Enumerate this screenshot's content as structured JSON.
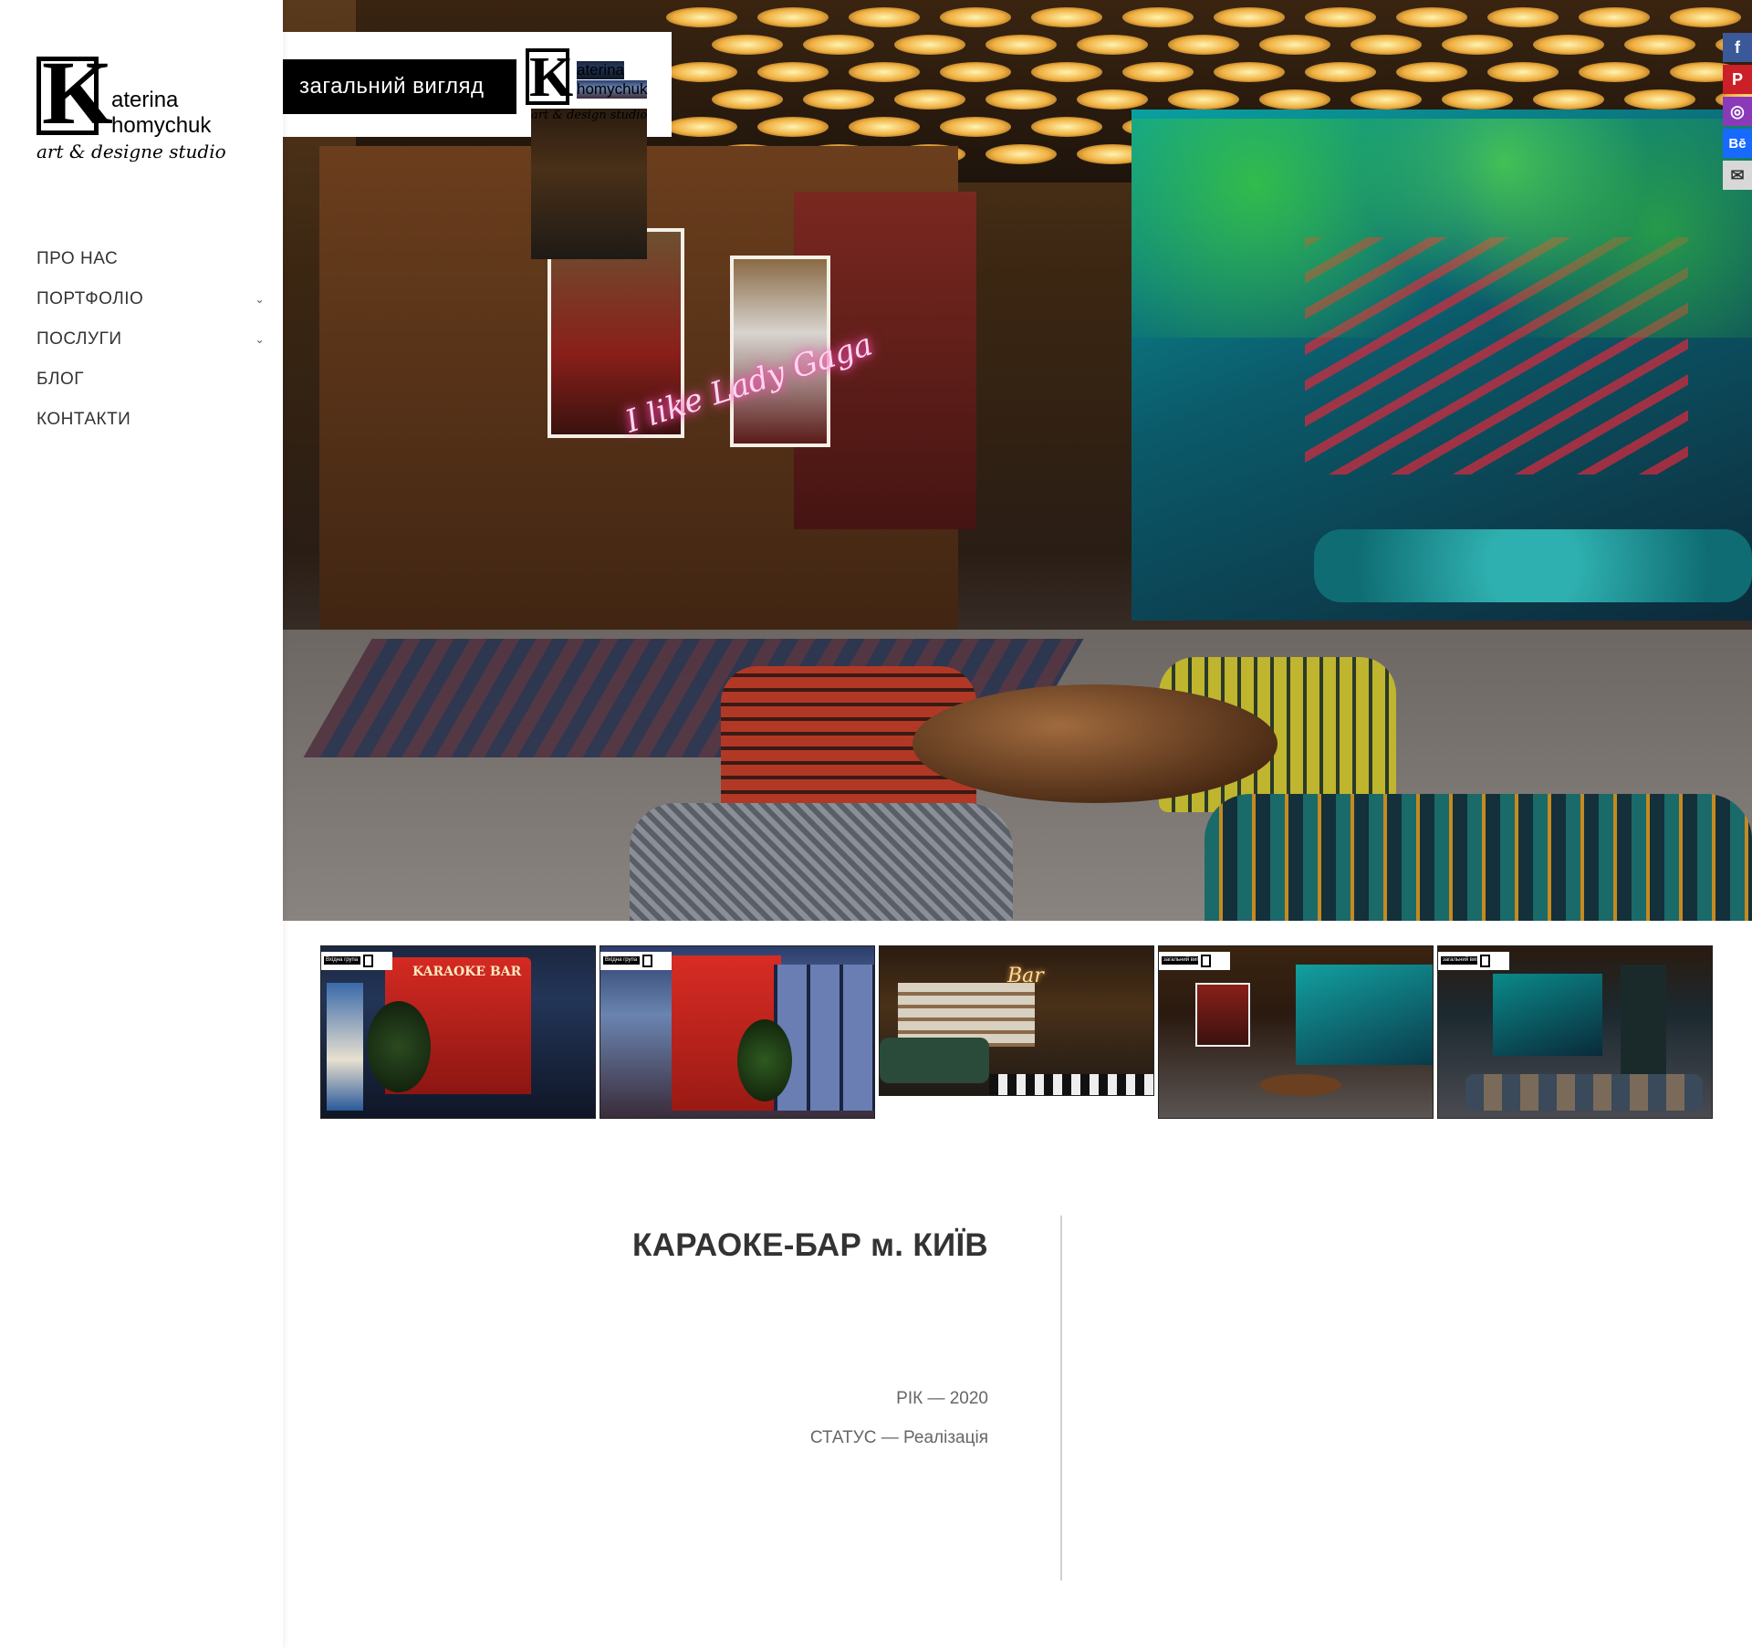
{
  "brand": {
    "logo_letter": "K",
    "logo_line1": "aterina",
    "logo_line2": "homychuk",
    "logo_tagline": "art & designe studio"
  },
  "nav": {
    "items": [
      {
        "label": "ПРО НАС",
        "has_submenu": false
      },
      {
        "label": "ПОРТФОЛІО",
        "has_submenu": true
      },
      {
        "label": "ПОСЛУГИ",
        "has_submenu": true
      },
      {
        "label": "БЛОГ",
        "has_submenu": false
      },
      {
        "label": "КОНТАКТИ",
        "has_submenu": false
      }
    ],
    "chevron": "⌄"
  },
  "hero": {
    "overlay_label": "загальний вигляд",
    "mini_logo_letter": "K",
    "mini_logo_line1": "aterina",
    "mini_logo_line2": "homychuk",
    "mini_logo_tagline": "art & design studio",
    "neon_text": "I like Lady Gaga"
  },
  "social": [
    {
      "icon": "facebook-icon",
      "glyph": "f",
      "color": "#3b5998"
    },
    {
      "icon": "pinterest-icon",
      "glyph": "P",
      "color": "#cb2027"
    },
    {
      "icon": "instagram-icon",
      "glyph": "◎",
      "color": "#8a3ab9"
    },
    {
      "icon": "behance-icon",
      "glyph": "Bē",
      "color": "#1769ff"
    },
    {
      "icon": "email-icon",
      "glyph": "✉",
      "color": "#d8d8d8"
    }
  ],
  "thumbnails": [
    {
      "name": "thumb-entrance",
      "sign": "KARAOKE BAR",
      "tag": "Вхідна група"
    },
    {
      "name": "thumb-entrance-side",
      "tag": "Вхідна група"
    },
    {
      "name": "thumb-bar",
      "sign": "Bar"
    },
    {
      "name": "thumb-general-view",
      "tag": "загальний вигляд"
    },
    {
      "name": "thumb-hall",
      "tag": "загальний вигляд"
    }
  ],
  "project": {
    "title": "КАРАОКЕ-БАР м. КИЇВ",
    "year": "РІК — 2020",
    "status": "СТАТУС — Реалізація"
  }
}
